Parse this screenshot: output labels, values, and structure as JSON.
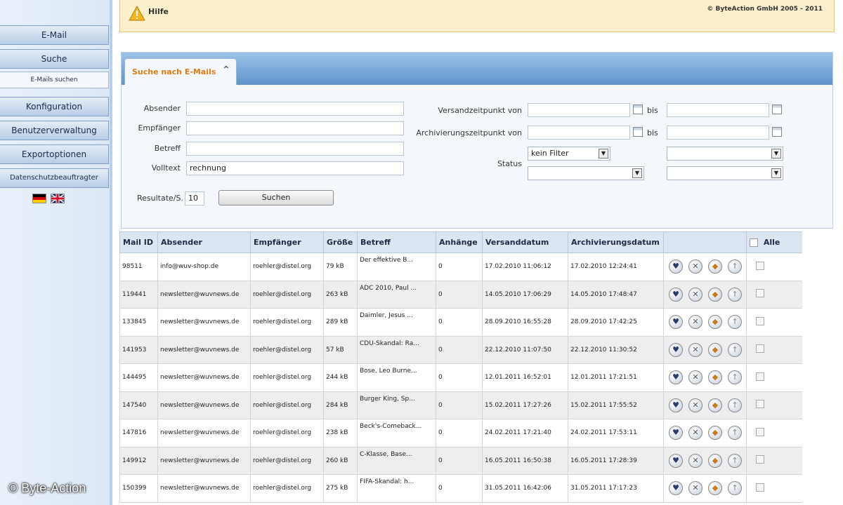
{
  "sidebar": {
    "items": [
      {
        "label": "E-Mail"
      },
      {
        "label": "Suche"
      },
      {
        "label": "E-Mails suchen"
      },
      {
        "label": "Konfiguration"
      },
      {
        "label": "Benutzerverwaltung"
      },
      {
        "label": "Exportoptionen"
      },
      {
        "label": "Datenschutzbeauftragter"
      }
    ],
    "flags": [
      "german-flag",
      "uk-flag"
    ]
  },
  "watermark": "© Byte-Action",
  "header": {
    "help": "Hilfe",
    "copyright": "© ByteAction GmbH 2005 - 2011"
  },
  "search": {
    "tab_label": "Suche nach E-Mails",
    "labels": {
      "sender": "Absender",
      "recipient": "Empfänger",
      "subject": "Betreff",
      "fulltext": "Volltext",
      "sent_from": "Versandzeitpunkt von",
      "archived_from": "Archivierungszeitpunkt von",
      "to": "bis",
      "status": "Status",
      "results_per_page": "Resultate/S."
    },
    "values": {
      "sender": "",
      "recipient": "",
      "subject": "",
      "fulltext": "rechnung",
      "sent_from": "",
      "sent_to": "",
      "archived_from": "",
      "archived_to": "",
      "status_1": "kein Filter",
      "status_2": "",
      "status_3": "",
      "status_4": "",
      "results_per_page": "10"
    },
    "button": "Suchen"
  },
  "table": {
    "headers": [
      "Mail ID",
      "Absender",
      "Empfänger",
      "Größe",
      "Betreff",
      "Anhänge",
      "Versanddatum",
      "Archivierungsdatum",
      "",
      "Alle"
    ],
    "rows": [
      [
        "98511",
        "info@wuv-shop.de",
        "roehler@distel.org",
        "79 kB",
        "Der effektive B...",
        "0",
        "17.02.2010 11:06:12",
        "17.02.2010 12:24:41"
      ],
      [
        "119441",
        "newsletter@wuvnews.de",
        "roehler@distel.org",
        "263 kB",
        "ADC 2010, Paul ...",
        "0",
        "14.05.2010 17:06:29",
        "14.05.2010 17:48:47"
      ],
      [
        "133845",
        "newsletter@wuvnews.de",
        "roehler@distel.org",
        "289 kB",
        "Daimler, Jesus ...",
        "0",
        "28.09.2010 16:55:28",
        "28.09.2010 17:42:25"
      ],
      [
        "141953",
        "newsletter@wuvnews.de",
        "roehler@distel.org",
        "57 kB",
        "CDU-Skandal: Ra...",
        "0",
        "22.12.2010 11:07:50",
        "22.12.2010 11:30:52"
      ],
      [
        "144495",
        "newsletter@wuvnews.de",
        "roehler@distel.org",
        "244 kB",
        "Bose, Leo Burne...",
        "0",
        "12.01.2011 16:52:01",
        "12.01.2011 17:21:51"
      ],
      [
        "147540",
        "newsletter@wuvnews.de",
        "roehler@distel.org",
        "284 kB",
        "Burger King, Sp...",
        "0",
        "15.02.2011 17:27:26",
        "15.02.2011 17:55:52"
      ],
      [
        "147816",
        "newsletter@wuvnews.de",
        "roehler@distel.org",
        "238 kB",
        "Beck's-Comeback...",
        "0",
        "24.02.2011 17:21:40",
        "24.02.2011 17:53:11"
      ],
      [
        "149912",
        "newsletter@wuvnews.de",
        "roehler@distel.org",
        "260 kB",
        "C-Klasse, Base...",
        "0",
        "16.05.2011 16:50:38",
        "16.05.2011 17:28:39"
      ],
      [
        "150399",
        "newsletter@wuvnews.de",
        "roehler@distel.org",
        "275 kB",
        "FIFA-Skandal: h...",
        "0",
        "31.05.2011 16:42:06",
        "31.05.2011 17:17:23"
      ]
    ],
    "actions": [
      {
        "icon": "view-icon",
        "glyph": "♥"
      },
      {
        "icon": "delete-icon",
        "glyph": "✕"
      },
      {
        "icon": "restore-icon",
        "glyph": "◆"
      },
      {
        "icon": "export-icon",
        "glyph": "↑"
      },
      {
        "icon": "info-icon",
        "glyph": "§"
      }
    ]
  }
}
